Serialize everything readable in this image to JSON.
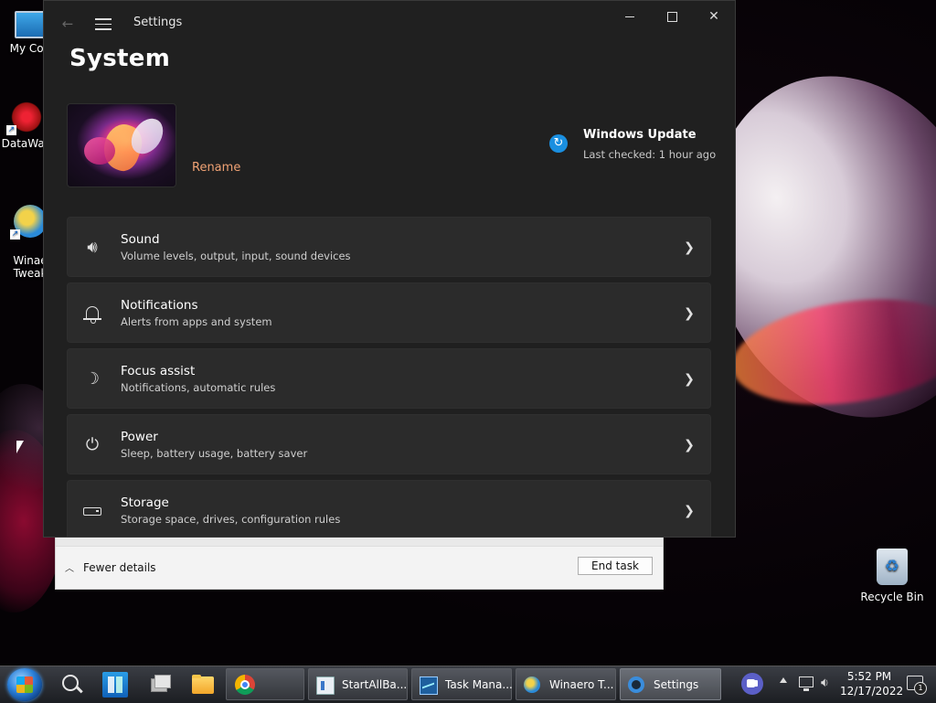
{
  "desktop": {
    "icons": [
      {
        "label": "My Com"
      },
      {
        "label": "DataWag"
      },
      {
        "label": "Winae\nTweak"
      }
    ],
    "recycle_bin": "Recycle Bin"
  },
  "settings_window": {
    "title": "Settings",
    "page_title": "System",
    "rename_label": "Rename",
    "windows_update": {
      "title": "Windows Update",
      "subtitle": "Last checked: 1 hour ago"
    },
    "items": [
      {
        "title": "Sound",
        "subtitle": "Volume levels, output, input, sound devices",
        "icon": "speaker-icon"
      },
      {
        "title": "Notifications",
        "subtitle": "Alerts from apps and system",
        "icon": "bell-icon"
      },
      {
        "title": "Focus assist",
        "subtitle": "Notifications, automatic rules",
        "icon": "moon-icon"
      },
      {
        "title": "Power",
        "subtitle": "Sleep, battery usage, battery saver",
        "icon": "power-icon"
      },
      {
        "title": "Storage",
        "subtitle": "Storage space, drives, configuration rules",
        "icon": "drive-icon"
      }
    ]
  },
  "task_manager": {
    "fewer_details": "Fewer details",
    "end_task": "End task"
  },
  "taskbar": {
    "buttons": [
      {
        "label": "StartAllBa..."
      },
      {
        "label": "Task Mana..."
      },
      {
        "label": "Winaero T..."
      },
      {
        "label": "Settings"
      }
    ],
    "clock": {
      "time": "5:52 PM",
      "date": "12/17/2022"
    },
    "notification_count": "1"
  },
  "colors": {
    "accent_link": "#f0a274",
    "update_blue": "#1a8fe0",
    "window_bg": "#202020",
    "card_bg": "#2b2b2b"
  }
}
